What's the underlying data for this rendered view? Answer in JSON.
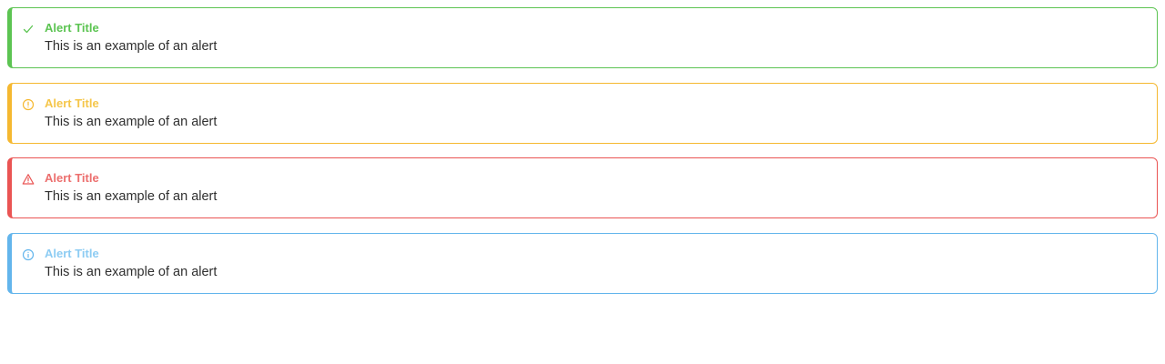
{
  "alerts": [
    {
      "type": "success",
      "icon": "check-icon",
      "title": "Alert Title",
      "message": "This is an example of an alert",
      "color": "#5cc452"
    },
    {
      "type": "warning",
      "icon": "warning-circle-icon",
      "title": "Alert Title",
      "message": "This is an example of an alert",
      "color": "#f5b830"
    },
    {
      "type": "error",
      "icon": "warning-triangle-icon",
      "title": "Alert Title",
      "message": "This is an example of an alert",
      "color": "#ea5453"
    },
    {
      "type": "info",
      "icon": "info-circle-icon",
      "title": "Alert Title",
      "message": "This is an example of an alert",
      "color": "#63b5ec"
    }
  ]
}
